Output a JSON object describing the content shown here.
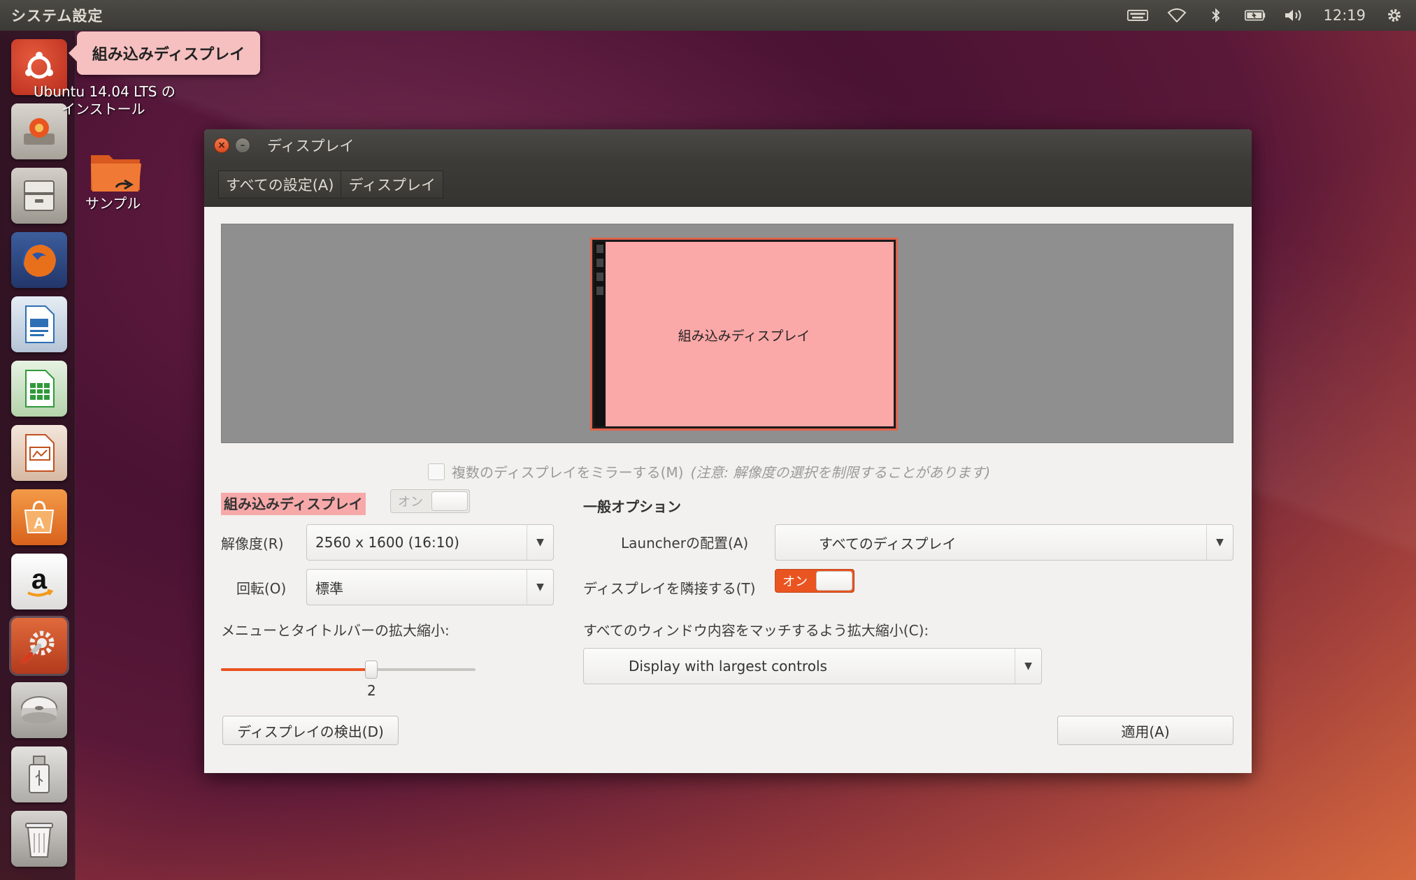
{
  "top_panel": {
    "app_title": "システム設定",
    "clock": "12:19",
    "indicators": [
      "keyboard-icon",
      "wifi-icon",
      "bluetooth-icon",
      "battery-icon",
      "volume-icon",
      "gear-icon"
    ]
  },
  "tooltip": {
    "text": "組み込みディスプレイ"
  },
  "desktop": {
    "installer_label_line1": "Ubuntu 14.04 LTS の",
    "installer_label_line2": "インストール",
    "folder_label": "サンプル"
  },
  "launcher": {
    "items": [
      "dash-home",
      "installer",
      "files",
      "firefox",
      "writer",
      "calc",
      "impress",
      "software-center",
      "amazon",
      "system-settings",
      "disk",
      "usb",
      "trash"
    ]
  },
  "window": {
    "title": "ディスプレイ",
    "breadcrumbs": [
      "すべての設定(A)",
      "ディスプレイ"
    ],
    "monitor_label": "組み込みディスプレイ",
    "mirror_label": "複数のディスプレイをミラーする(M)",
    "mirror_note": "(注意: 解像度の選択を制限することがあります)",
    "display_heading": "組み込みディスプレイ",
    "display_toggle": "オン",
    "resolution_label": "解像度(R)",
    "resolution_value": "2560 x 1600 (16:10)",
    "rotation_label": "回転(O)",
    "rotation_value": "標準",
    "scale_label": "メニューとタイトルバーの拡大縮小:",
    "scale_value": "2",
    "scale_fraction": 0.59,
    "general_heading": "一般オプション",
    "launcher_label": "Launcherの配置(A)",
    "launcher_value": "すべてのディスプレイ",
    "sticky_label": "ディスプレイを隣接する(T)",
    "sticky_toggle": "オン",
    "match_label": "すべてのウィンドウ内容をマッチするよう拡大縮小(C):",
    "match_value": "Display with largest controls",
    "detect_button": "ディスプレイの検出(D)",
    "apply_button": "適用(A)"
  },
  "colors": {
    "accent": "#e95420",
    "monitor_fill": "#fba8a8",
    "highlight": "#f7a9a9"
  }
}
